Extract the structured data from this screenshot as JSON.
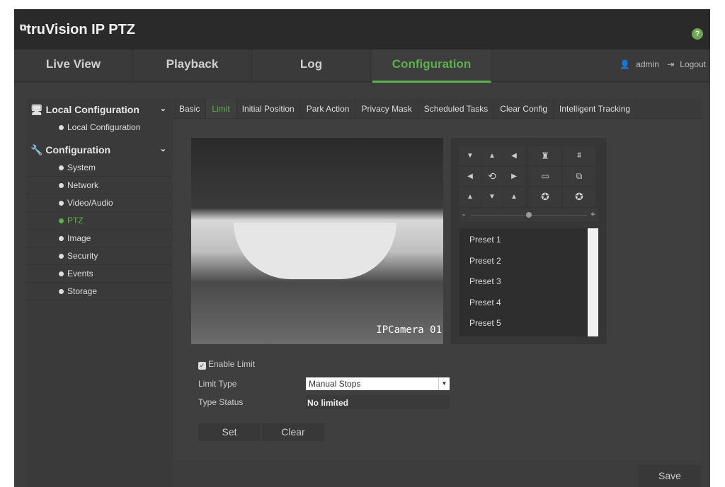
{
  "header": {
    "logo": "truVision IP PTZ",
    "help": "?"
  },
  "nav": {
    "tabs": [
      "Live View",
      "Playback",
      "Log",
      "Configuration"
    ],
    "active": "Configuration",
    "user": "admin",
    "logout": "Logout"
  },
  "sidebar": {
    "local_header": "Local Configuration",
    "local_items": [
      "Local Configuration"
    ],
    "config_header": "Configuration",
    "config_items": [
      "System",
      "Network",
      "Video/Audio",
      "PTZ",
      "Image",
      "Security",
      "Events",
      "Storage"
    ],
    "active": "PTZ"
  },
  "tabs": [
    "Basic",
    "Limit",
    "Initial Position",
    "Park Action",
    "Privacy Mask",
    "Scheduled Tasks",
    "Clear Config",
    "Intelligent Tracking"
  ],
  "active_tab": "Limit",
  "video": {
    "osd": "IPCamera 01"
  },
  "ptz": {
    "zoom_minus": "-",
    "zoom_plus": "+",
    "zoom_level": 0.5,
    "presets": [
      "Preset 1",
      "Preset 2",
      "Preset 3",
      "Preset 4",
      "Preset 5"
    ]
  },
  "form": {
    "enable_label": "Enable Limit",
    "enable_checked": true,
    "limit_type_label": "Limit Type",
    "limit_type_value": "Manual Stops",
    "type_status_label": "Type Status",
    "type_status_value": "No limited",
    "set": "Set",
    "clear": "Clear"
  },
  "save": "Save",
  "colors": {
    "accent": "#5db14a",
    "header": "#2a2a2a",
    "background": "#3d3d3d"
  }
}
